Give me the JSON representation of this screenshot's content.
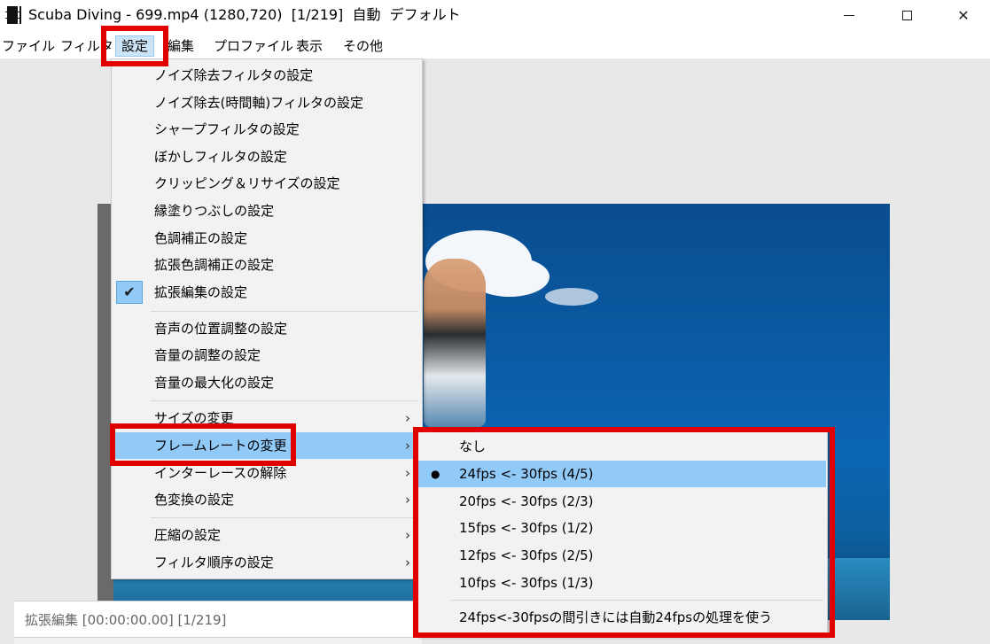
{
  "window": {
    "title": "Scuba Diving - 699.mp4 (1280,720)  [1/219]  自動  デフォルト",
    "minimize_label": "",
    "maximize_label": "",
    "close_label": "✕"
  },
  "menubar": {
    "items": [
      {
        "label": "ファイル"
      },
      {
        "label": "フィルタ"
      },
      {
        "label": "設定"
      },
      {
        "label": "編集"
      },
      {
        "label": "プロファイル"
      },
      {
        "label": "表示"
      },
      {
        "label": "その他"
      }
    ]
  },
  "settings_menu": {
    "items": [
      {
        "label": "ノイズ除去フィルタの設定"
      },
      {
        "label": "ノイズ除去(時間軸)フィルタの設定"
      },
      {
        "label": "シャープフィルタの設定"
      },
      {
        "label": "ぼかしフィルタの設定"
      },
      {
        "label": "クリッピング＆リサイズの設定"
      },
      {
        "label": "縁塗りつぶしの設定"
      },
      {
        "label": "色調補正の設定"
      },
      {
        "label": "拡張色調補正の設定"
      },
      {
        "label": "拡張編集の設定",
        "checked": true
      },
      {
        "label": "音声の位置調整の設定"
      },
      {
        "label": "音量の調整の設定"
      },
      {
        "label": "音量の最大化の設定"
      },
      {
        "label": "サイズの変更",
        "submenu": true
      },
      {
        "label": "フレームレートの変更",
        "submenu": true,
        "highlighted": true
      },
      {
        "label": "インターレースの解除",
        "submenu": true
      },
      {
        "label": "色変換の設定",
        "submenu": true
      },
      {
        "label": "圧縮の設定",
        "submenu": true
      },
      {
        "label": "フィルタ順序の設定",
        "submenu": true
      }
    ],
    "check_glyph": "✔",
    "arrow_glyph": "›"
  },
  "framerate_menu": {
    "items": [
      {
        "label": "なし"
      },
      {
        "label": "24fps <- 30fps  (4/5)",
        "selected": true
      },
      {
        "label": "20fps <- 30fps  (2/3)"
      },
      {
        "label": "15fps <- 30fps  (1/2)"
      },
      {
        "label": "12fps <- 30fps  (2/5)"
      },
      {
        "label": "10fps <- 30fps  (1/3)"
      },
      {
        "label": "24fps<-30fpsの間引きには自動24fpsの処理を使う"
      }
    ],
    "bullet_glyph": "●"
  },
  "status": {
    "text": "拡張編集 [00:00:00.00] [1/219]"
  },
  "colors": {
    "highlight": "#91c9f7",
    "annotation_red": "#e00000",
    "menu_bg": "#f2f2f2"
  }
}
